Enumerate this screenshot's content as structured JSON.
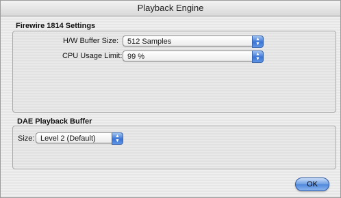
{
  "window": {
    "title": "Playback Engine"
  },
  "firewire_section": {
    "title": "Firewire 1814 Settings",
    "hw_buffer": {
      "label": "H/W Buffer Size:",
      "value": "512 Samples"
    },
    "cpu_usage": {
      "label": "CPU Usage Limit:",
      "value": "99 %"
    }
  },
  "dae_section": {
    "title": "DAE Playback Buffer",
    "size": {
      "label": "Size:",
      "value": "Level 2 (Default)"
    }
  },
  "buttons": {
    "ok": "OK"
  },
  "colors": {
    "accent": "#3a73d4"
  }
}
